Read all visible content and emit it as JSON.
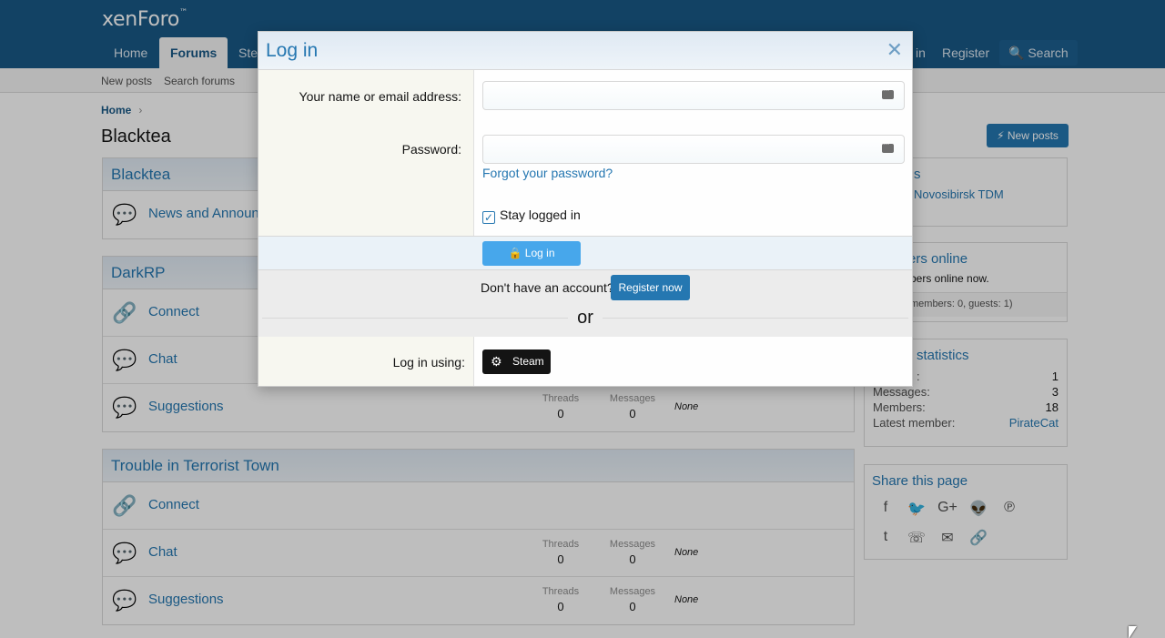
{
  "header": {
    "logo": "xenForo",
    "logo_tm": "™",
    "tabs": [
      "Home",
      "Forums",
      "Ste"
    ],
    "right": {
      "login": "in",
      "register": "Register",
      "search": "Search"
    }
  },
  "subnav": {
    "new_posts": "New posts",
    "search_forums": "Search forums"
  },
  "breadcrumb": {
    "home": "Home"
  },
  "page_title": "Blacktea",
  "new_posts_button": "New posts",
  "categories": [
    {
      "title": "Blacktea",
      "nodes": [
        {
          "title": "News and Announ"
        }
      ]
    },
    {
      "title": "DarkRP",
      "nodes": [
        {
          "title": "Connect"
        },
        {
          "title": "Chat"
        },
        {
          "title": "Suggestions",
          "threads_label": "Threads",
          "threads": "0",
          "messages_label": "Messages",
          "messages": "0",
          "last": "None"
        }
      ]
    },
    {
      "title": "Trouble in Terrorist Town",
      "nodes": [
        {
          "title": "Connect"
        },
        {
          "title": "Chat",
          "threads_label": "Threads",
          "threads": "0",
          "messages_label": "Messages",
          "messages": "0",
          "last": "None"
        },
        {
          "title": "Suggestions",
          "threads_label": "Threads",
          "threads": "0",
          "messages_label": "Messages",
          "messages": "0",
          "last": "None"
        }
      ]
    }
  ],
  "sidebar": {
    "servers": {
      "title": "s",
      "item": "Novosibirsk TDM"
    },
    "members_online": {
      "title": "ers online",
      "text": "bers online now.",
      "footer": "members: 0, guests: 1)"
    },
    "stats": {
      "title": "statistics",
      "rows": [
        {
          "label": ":",
          "value": "1"
        },
        {
          "label": "Messages:",
          "value": "3"
        },
        {
          "label": "Members:",
          "value": "18"
        },
        {
          "label": "Latest member:",
          "value": "PirateCat"
        }
      ]
    },
    "share": {
      "title": "Share this page"
    }
  },
  "modal": {
    "title": "Log in",
    "close": "✕",
    "name_label": "Your name or email address:",
    "password_label": "Password:",
    "forgot": "Forgot your password?",
    "stay_logged_in": "Stay logged in",
    "login_button": "Log in",
    "dont_have": "Don't have an account?",
    "register_button": "Register now",
    "or": "or",
    "login_using": "Log in using:",
    "steam_button": "Steam"
  }
}
